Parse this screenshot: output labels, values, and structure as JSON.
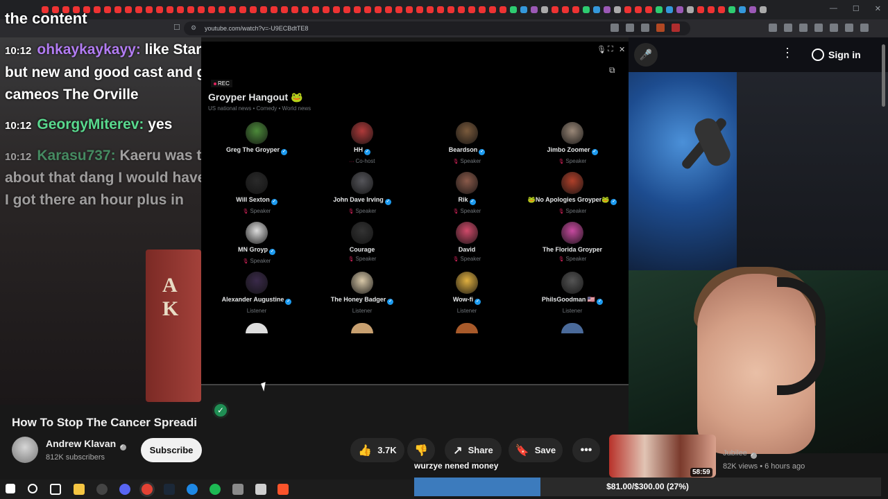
{
  "browser": {
    "url": "youtube.com/watch?v=-U9ECBdtTE8"
  },
  "chat": {
    "top_line": "the content",
    "messages": [
      {
        "time": "10:12",
        "user": "ohkaykaykayy:",
        "user_color": "#b27cf2",
        "text": "like Star Trek"
      },
      {
        "time": "",
        "user": "",
        "user_color": "#fff",
        "text": "but new and good cast and good"
      },
      {
        "time": "",
        "user": "",
        "user_color": "#fff",
        "text": "cameos The Orville"
      },
      {
        "time": "10:12",
        "user": "GeorgyMiterev:",
        "user_color": "#59d98e",
        "text": "yes"
      },
      {
        "time": "10:12",
        "user": "Karasu737:",
        "user_color": "#59d98e",
        "text": "Kaeru was talking"
      },
      {
        "time": "",
        "user": "",
        "user_color": "#fff",
        "text": "about that dang I would have listened"
      },
      {
        "time": "",
        "user": "",
        "user_color": "#fff",
        "text": "I got there an hour plus in"
      }
    ]
  },
  "header": {
    "sign_in": "Sign in"
  },
  "space": {
    "rec_label": "REC",
    "title": "Groyper Hangout 🐸",
    "subtitle": "US national news • Comedy • World news",
    "participants": [
      {
        "name": "Greg The Groyper",
        "role": "",
        "color": "#4c8a3a",
        "verified": true
      },
      {
        "name": "HH",
        "role": "Co-host",
        "color": "#b03a3a",
        "verified": true
      },
      {
        "name": "Beardson",
        "role": "Speaker",
        "color": "#7a5a3c",
        "verified": true
      },
      {
        "name": "Jimbo Zoomer",
        "role": "Speaker",
        "color": "#9a8878",
        "verified": true
      },
      {
        "name": "Will Sexton",
        "role": "Speaker",
        "color": "#2a2a2a",
        "verified": true
      },
      {
        "name": "John Dave Irving",
        "role": "Speaker",
        "color": "#55555a",
        "verified": true
      },
      {
        "name": "Rik",
        "role": "Speaker",
        "color": "#8a5a4a",
        "verified": true
      },
      {
        "name": "🐸No Apologies Groyper🐸",
        "role": "Speaker",
        "color": "#b0402a",
        "verified": true
      },
      {
        "name": "MN Groyp",
        "role": "Speaker",
        "color": "#dddddd",
        "verified": true
      },
      {
        "name": "Courage",
        "role": "Speaker",
        "color": "#333333",
        "verified": false
      },
      {
        "name": "David",
        "role": "Speaker",
        "color": "#d04a6a",
        "verified": false
      },
      {
        "name": "The Florida Groyper",
        "role": "Speaker",
        "color": "#c84aa0",
        "verified": false
      },
      {
        "name": "Alexander Augustine",
        "role": "Listener",
        "color": "#3a2a4a",
        "verified": true
      },
      {
        "name": "The Honey Badger",
        "role": "Listener",
        "color": "#d8c8a8",
        "verified": true
      },
      {
        "name": "Wow-fi",
        "role": "Listener",
        "color": "#e0b040",
        "verified": true
      },
      {
        "name": "PhilsGoodman 🇺🇸",
        "role": "Listener",
        "color": "#555555",
        "verified": true
      }
    ]
  },
  "video": {
    "title": "How To Stop The Cancer Spreadi",
    "channel": "Andrew Klavan",
    "subscribers": "812K subscribers",
    "subscribe_label": "Subscribe",
    "likes": "3.7K",
    "share_label": "Share",
    "save_label": "Save",
    "book_text": "A\nK"
  },
  "recommended": {
    "duration": "58:59",
    "channel": "Jubilee",
    "meta": "82K views • 6 hours ago"
  },
  "donation": {
    "message": "wurzye nened money",
    "goal_text": "$81.00/$300.00 (27%)",
    "progress": 0.27
  }
}
